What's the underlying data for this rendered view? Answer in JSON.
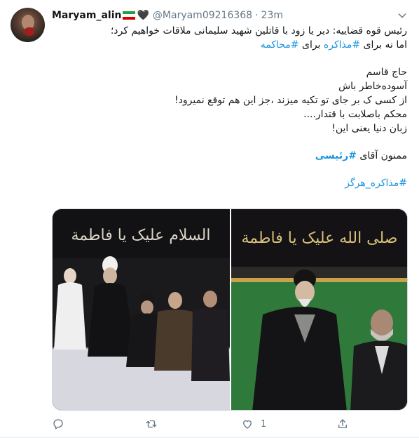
{
  "user": {
    "name": "Maryam_alin",
    "handle": "@Maryam09216368",
    "time": "23m"
  },
  "tweet": {
    "lines": [
      "رئیس قوه قضاییه: دیر یا زود با قاتلین شهید سلیمانی ملاقات خواهیم کرد؛",
      "اما نه برای",
      "#مذاکره",
      "برای",
      "#محاکمه",
      "حاج قاسم",
      "آسوده‌خاطر باش",
      "از کسی ک بر جای تو تکیه میزند ،جز این هم توقع نمیرود!",
      "محکم باصلابت با قتدار....",
      "زبان دنیا یعنی این!",
      "ممنون آقای",
      "#رئیسی",
      "#مذاکره_هرگز"
    ]
  },
  "media": {
    "left_banner_text": "السلام علیک یا فاطمة",
    "right_banner_text": "صلی الله علیک یا فاطمة"
  },
  "actions": {
    "reply_count": "",
    "retweet_count": "",
    "like_count": "1",
    "share_count": ""
  },
  "colors": {
    "link": "#1b95e0",
    "muted": "#657786",
    "text": "#14171a"
  }
}
